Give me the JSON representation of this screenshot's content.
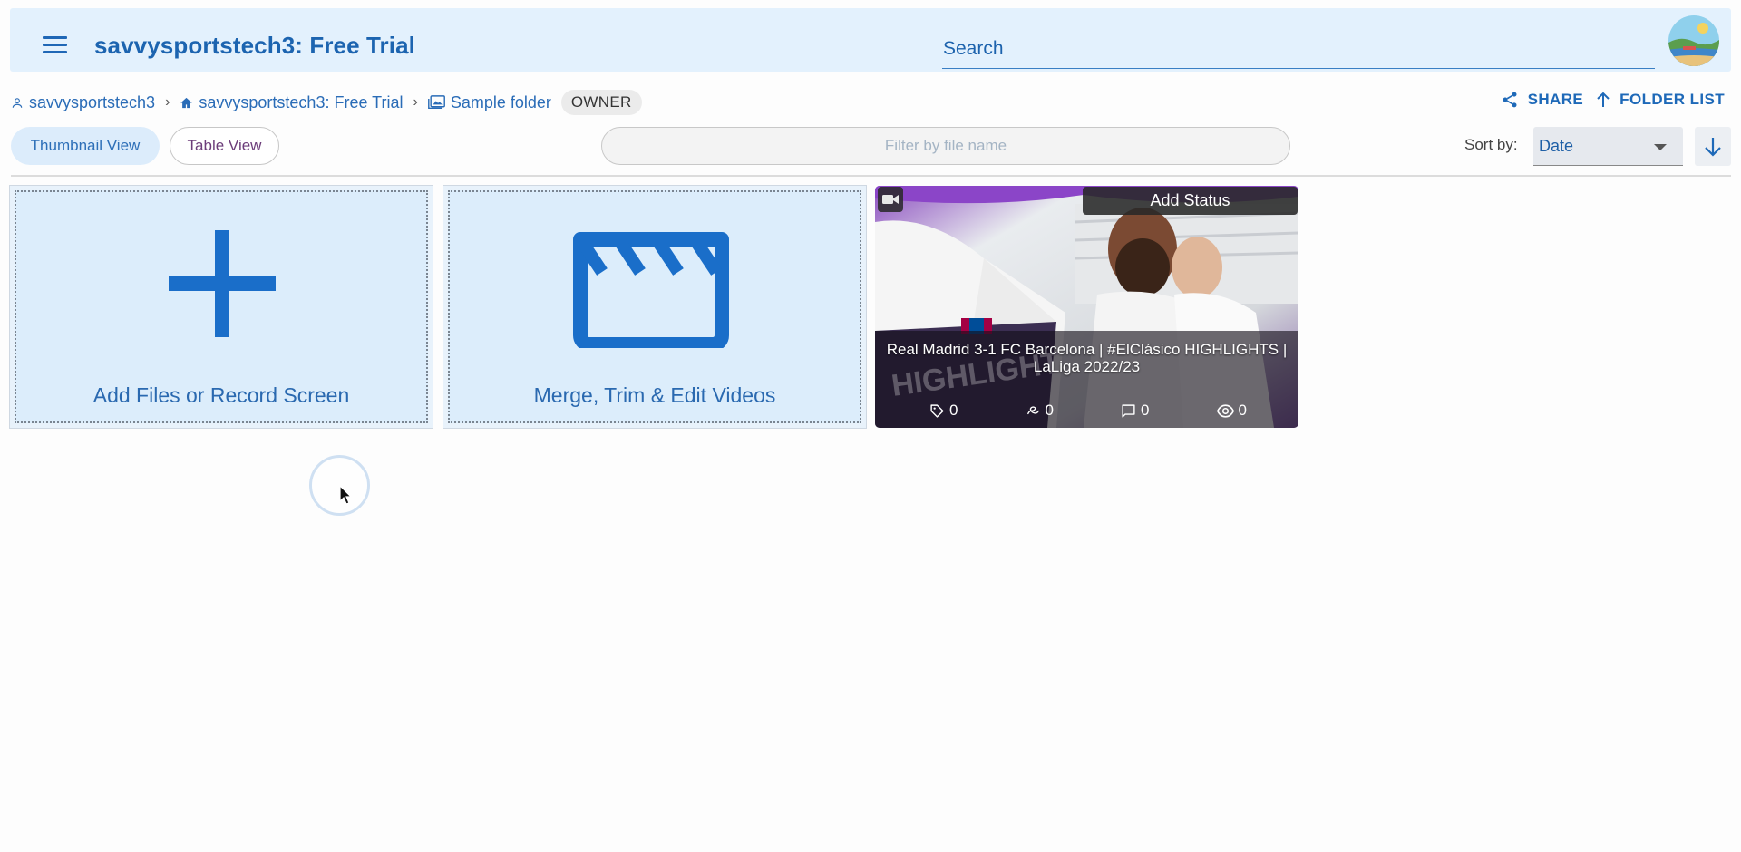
{
  "header": {
    "title": "savvysportstech3: Free Trial",
    "search_label": "Search"
  },
  "breadcrumb": {
    "items": [
      {
        "label": "savvysportstech3",
        "icon": "person-icon"
      },
      {
        "label": "savvysportstech3: Free Trial",
        "icon": "home-icon"
      },
      {
        "label": "Sample folder",
        "icon": "image-folder-icon"
      }
    ],
    "role_badge": "OWNER"
  },
  "actions": {
    "share_label": "SHARE",
    "folder_list_label": "FOLDER LIST"
  },
  "toolbar": {
    "thumbnail_view_label": "Thumbnail View",
    "table_view_label": "Table View",
    "filter_placeholder": "Filter by file name",
    "sort_by_label": "Sort by:",
    "sort_value": "Date",
    "sort_direction": "descending"
  },
  "cards": {
    "add_files_label": "Add Files or Record Screen",
    "edit_videos_label": "Merge, Trim & Edit Videos"
  },
  "video": {
    "status_label": "Add Status",
    "title": "Real Madrid 3-1 FC Barcelona | #ElClásico HIGHLIGHTS | LaLiga 2022/23",
    "tags_count": "0",
    "assignments_count": "0",
    "comments_count": "0",
    "views_count": "0"
  },
  "colors": {
    "accent": "#1c64b0",
    "header_bg": "#e3f1fd",
    "card_bg": "#dcedfb",
    "icon_blue": "#1a6ec9"
  }
}
